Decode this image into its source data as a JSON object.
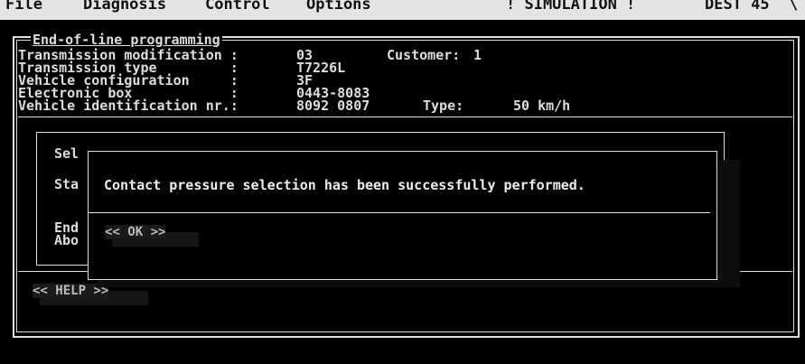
{
  "menubar": {
    "items": [
      "File",
      "Diagnosis",
      "Control",
      "Options"
    ],
    "simulation": "! SIMULATION !",
    "dest": "DEST 45",
    "corner": "\\"
  },
  "panel": {
    "title": "End-of-line programming",
    "rows": [
      {
        "label": "Transmission modification :",
        "value": "03",
        "extra_label": "Customer:",
        "extra_value": "1"
      },
      {
        "label": "Transmission type         :",
        "value": "T7226L"
      },
      {
        "label": "Vehicle configuration     :",
        "value": "3F"
      },
      {
        "label": "Electronic box            :",
        "value": "0443-8083"
      },
      {
        "label": "Vehicle identification nr.:",
        "value": "8092 0807",
        "extra_label": "Type:",
        "extra_value": "50 km/h"
      }
    ]
  },
  "background_labels": [
    "Sel",
    "Sta",
    "End",
    "Abo"
  ],
  "dialog": {
    "message": "Contact pressure selection has been successfully performed.",
    "ok_label": "<< OK >>"
  },
  "help_label": "<< HELP >>"
}
